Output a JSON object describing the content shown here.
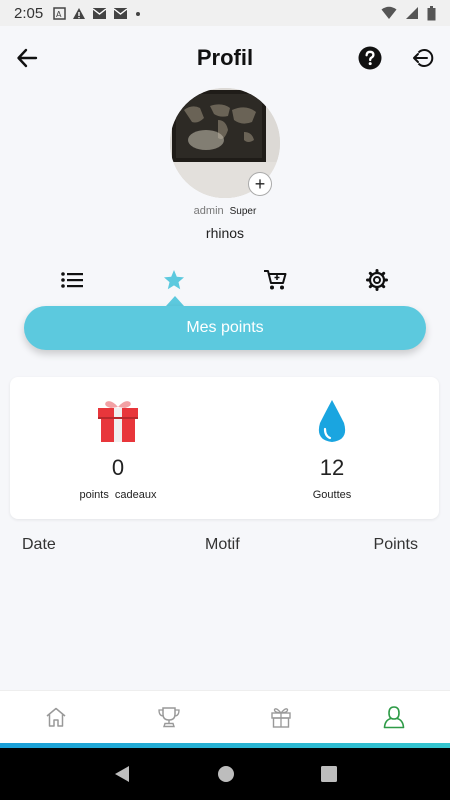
{
  "status_bar": {
    "time": "2:05",
    "icons": [
      "sim-icon",
      "warning-icon",
      "mail-icon",
      "mail-icon",
      "dot-icon"
    ],
    "right_icons": [
      "wifi-icon",
      "signal-icon",
      "battery-icon"
    ]
  },
  "header": {
    "title": "Profil",
    "back_icon": "arrow-left-icon",
    "help_icon": "help-circle-icon",
    "logout_icon": "logout-icon"
  },
  "profile": {
    "role": "admin",
    "badge": "Super",
    "name": "rhinos",
    "add_photo": "+"
  },
  "tabs": {
    "items": [
      "list-icon",
      "star-icon",
      "cart-icon",
      "gear-icon"
    ],
    "active": "star-icon",
    "accent_color": "#5cc9de"
  },
  "section": {
    "label": "Mes points"
  },
  "stats": {
    "gifts": {
      "value": "0",
      "label": "points  cadeaux",
      "icon": "gift-icon",
      "color": "#e8363b"
    },
    "drops": {
      "value": "12",
      "label": "Gouttes",
      "icon": "water-drop-icon",
      "color": "#1aa5e0"
    }
  },
  "table": {
    "columns": [
      "Date",
      "Motif",
      "Points"
    ]
  },
  "bottom_nav": {
    "items": [
      "home-icon",
      "trophy-icon",
      "gift-icon",
      "user-icon"
    ],
    "active": "user-icon",
    "active_color": "#2e9b47"
  },
  "system_nav": [
    "back-triangle-icon",
    "home-circle-icon",
    "recents-square-icon"
  ]
}
